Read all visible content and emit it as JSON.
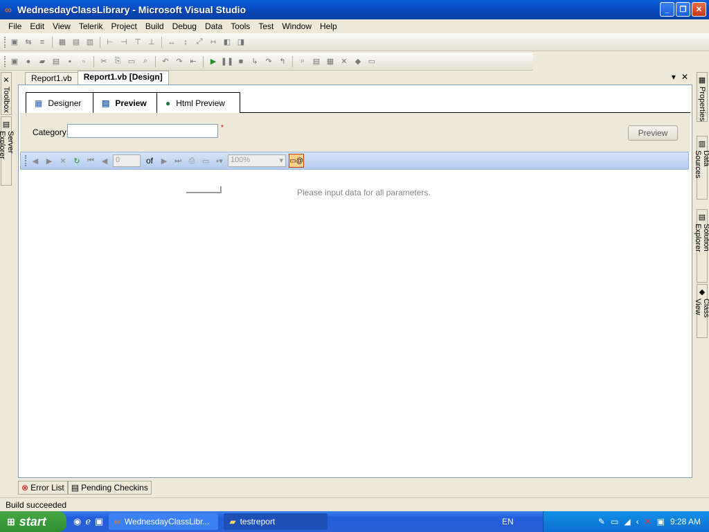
{
  "window": {
    "title": "WednesdayClassLibrary - Microsoft Visual Studio"
  },
  "menu": [
    "File",
    "Edit",
    "View",
    "Telerik",
    "Project",
    "Build",
    "Debug",
    "Data",
    "Tools",
    "Test",
    "Window",
    "Help"
  ],
  "side_left": [
    "Toolbox",
    "Server Explorer"
  ],
  "side_right": [
    "Properties",
    "Data Sources",
    "Solution Explorer",
    "Class View"
  ],
  "doc_tabs": [
    {
      "label": "Report1.vb",
      "active": false
    },
    {
      "label": "Report1.vb [Design]",
      "active": true
    }
  ],
  "inner_tabs": [
    {
      "label": "Designer"
    },
    {
      "label": "Preview"
    },
    {
      "label": "Html Preview"
    }
  ],
  "params": {
    "category_label": "Category:",
    "category_value": "",
    "required_mark": "*",
    "preview_button": "Preview"
  },
  "report_toolbar": {
    "page_value": "0",
    "of_label": "of",
    "zoom_value": "100%"
  },
  "report_body": {
    "message": "Please input data for all parameters."
  },
  "bottom_tabs": [
    "Error List",
    "Pending Checkins"
  ],
  "status": "Build succeeded",
  "taskbar": {
    "start": "start",
    "items": [
      "WednesdayClassLibr...",
      "testreport"
    ],
    "lang": "EN",
    "clock": "9:28 AM"
  }
}
